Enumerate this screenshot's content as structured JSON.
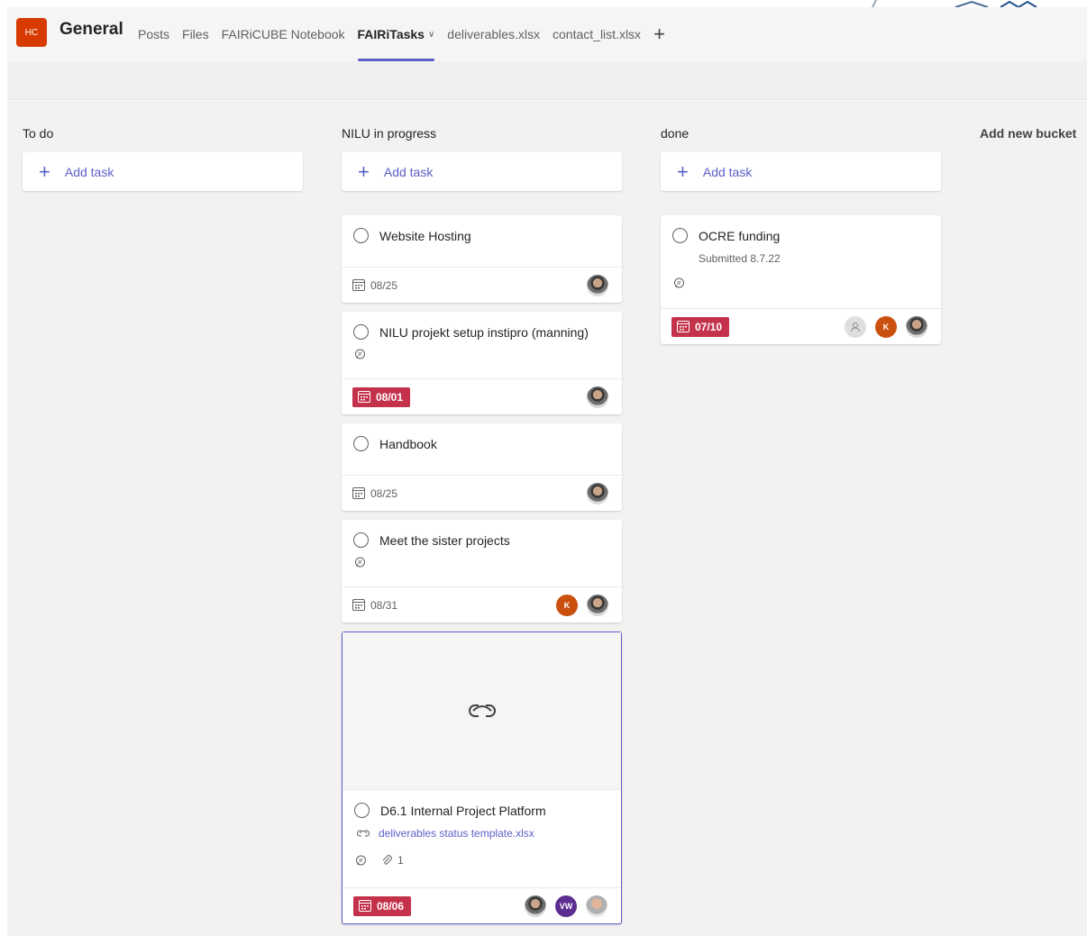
{
  "header": {
    "team_initials": "HC",
    "channel_name": "General",
    "tabs": [
      {
        "label": "Posts",
        "active": false
      },
      {
        "label": "Files",
        "active": false
      },
      {
        "label": "FAIRiCUBE Notebook",
        "active": false
      },
      {
        "label": "FAIRiTasks",
        "active": true
      },
      {
        "label": "deliverables.xlsx",
        "active": false
      },
      {
        "label": "contact_list.xlsx",
        "active": false
      }
    ],
    "add_tab_icon": "plus-icon",
    "accent_color": "#5b5fc7",
    "team_color": "#d83b01"
  },
  "board": {
    "add_task_label": "Add task",
    "add_bucket_label": "Add new bucket",
    "late_color": "#c4314b",
    "buckets": [
      {
        "name": "To do"
      },
      {
        "name": "NILU in progress"
      },
      {
        "name": "done"
      }
    ],
    "tasks": {
      "website_hosting": {
        "title": "Website Hosting",
        "due": "08/25"
      },
      "nilu_setup": {
        "title": "NILU projekt setup instipro (manning)",
        "due": "08/01"
      },
      "handbook": {
        "title": "Handbook",
        "due": "08/25"
      },
      "sister_projects": {
        "title": "Meet the sister projects",
        "due": "08/31",
        "assignee_initial": "K"
      },
      "d61": {
        "title": "D6.1 Internal Project Platform",
        "link": "deliverables status template.xlsx",
        "attachments": "1",
        "due": "08/06",
        "assignee_initials": "VW"
      },
      "ocre": {
        "title": "OCRE funding",
        "note": "Submitted 8.7.22",
        "due": "07/10",
        "assignee_initial": "K"
      }
    }
  }
}
